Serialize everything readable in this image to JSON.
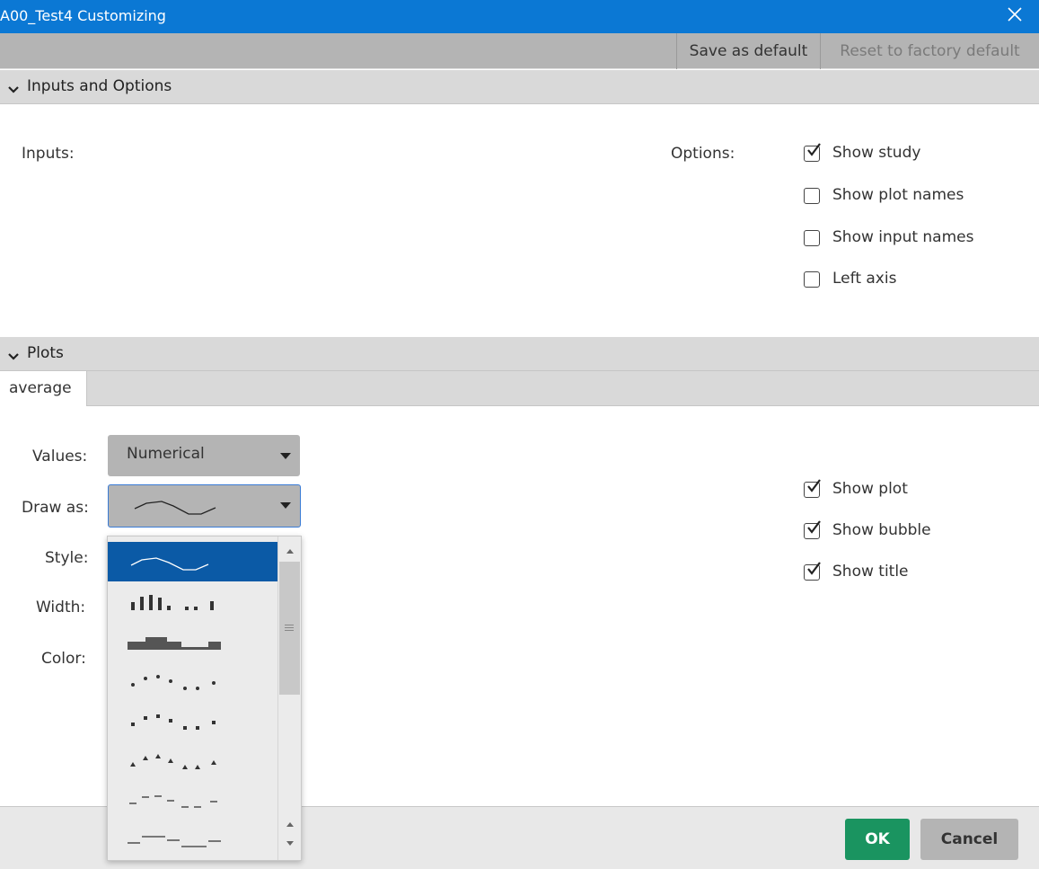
{
  "window": {
    "title": "A00_Test4 Customizing"
  },
  "toolbar": {
    "save_label": "Save as default",
    "reset_label": "Reset to factory default"
  },
  "sections": {
    "inputs_options": "Inputs and Options",
    "plots": "Plots"
  },
  "inputs": {
    "label": "Inputs:"
  },
  "options": {
    "label": "Options:",
    "items": [
      {
        "label": "Show study",
        "checked": true
      },
      {
        "label": "Show plot names",
        "checked": false
      },
      {
        "label": "Show input names",
        "checked": false
      },
      {
        "label": "Left axis",
        "checked": false
      }
    ]
  },
  "plots": {
    "tabs": [
      {
        "label": "average",
        "active": true
      }
    ],
    "values": {
      "label": "Values:",
      "selected": "Numerical"
    },
    "draw_as": {
      "label": "Draw as:",
      "selected_icon": "line-style-icon",
      "options": [
        {
          "icon": "line-style-icon",
          "selected": true
        },
        {
          "icon": "histogram-style-icon",
          "selected": false
        },
        {
          "icon": "step-histogram-style-icon",
          "selected": false
        },
        {
          "icon": "points-style-icon",
          "selected": false
        },
        {
          "icon": "squares-style-icon",
          "selected": false
        },
        {
          "icon": "triangles-style-icon",
          "selected": false
        },
        {
          "icon": "dashes-style-icon",
          "selected": false
        },
        {
          "icon": "horizontal-segments-style-icon",
          "selected": false
        }
      ]
    },
    "style": {
      "label": "Style:"
    },
    "width": {
      "label": "Width:"
    },
    "color": {
      "label": "Color:"
    },
    "checks": [
      {
        "label": "Show plot",
        "checked": true
      },
      {
        "label": "Show bubble",
        "checked": true
      },
      {
        "label": "Show title",
        "checked": true
      }
    ]
  },
  "footer": {
    "ok_label": "OK",
    "cancel_label": "Cancel"
  },
  "colors": {
    "titlebar": "#0b78d4",
    "selected_item": "#0b5aa6",
    "ok_button": "#1a9460",
    "toolbar": "#b4b4b4"
  }
}
